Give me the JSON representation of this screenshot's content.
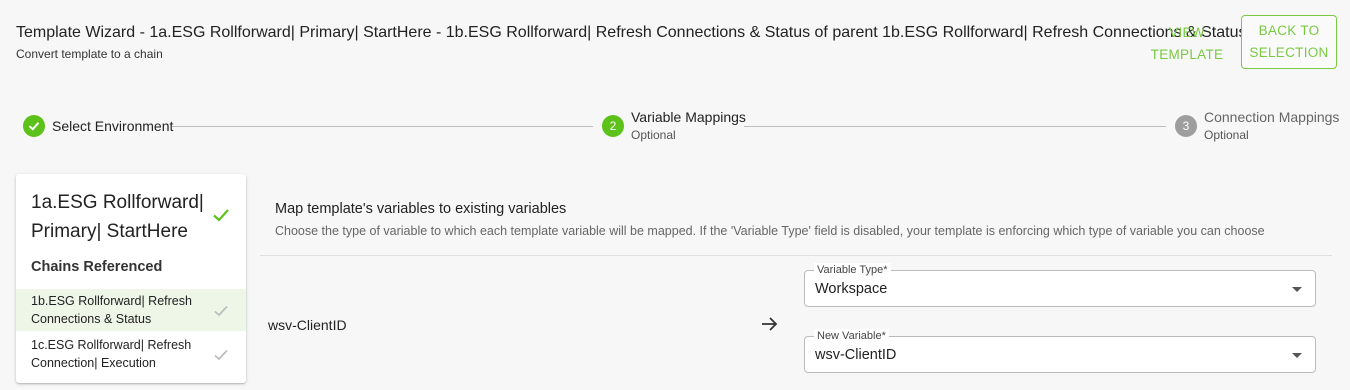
{
  "header": {
    "title": "Template Wizard - 1a.ESG Rollforward| Primary| StartHere - 1b.ESG Rollforward| Refresh Connections & Status of parent 1b.ESG Rollforward| Refresh Connections & Status",
    "subtitle": "Convert template to a chain",
    "view_template_line1": "VIEW",
    "view_template_line2": "TEMPLATE",
    "back_line1": "BACK TO",
    "back_line2": "SELECTION"
  },
  "stepper": {
    "steps": [
      {
        "label": "Select Environment",
        "optional": "",
        "number": "",
        "state": "complete",
        "icon": "check-icon"
      },
      {
        "label": "Variable Mappings",
        "optional": "Optional",
        "number": "2",
        "state": "active"
      },
      {
        "label": "Connection Mappings",
        "optional": "Optional",
        "number": "3",
        "state": "inactive"
      }
    ]
  },
  "left_panel": {
    "template_name": "1a.ESG Rollforward| Primary| StartHere",
    "chains_heading": "Chains Referenced",
    "chains": [
      {
        "label": "1b.ESG Rollforward| Refresh Connections & Status",
        "selected": true
      },
      {
        "label": "1c.ESG Rollforward| Refresh Connection| Execution",
        "selected": false
      }
    ]
  },
  "mapping": {
    "title": "Map template's variables to existing variables",
    "description": "Choose the type of variable to which each template variable will be mapped. If the 'Variable Type' field is disabled, your template is enforcing which type of variable you can choose",
    "rows": [
      {
        "variable": "wsv-ClientID",
        "variable_type_label": "Variable Type*",
        "variable_type_value": "Workspace",
        "new_variable_label": "New Variable*",
        "new_variable_value": "wsv-ClientID"
      }
    ]
  },
  "colors": {
    "accent": "#7ac943",
    "step_complete": "#5cc21a",
    "step_inactive": "#9e9e9e",
    "selected_row": "#eef6e8"
  }
}
